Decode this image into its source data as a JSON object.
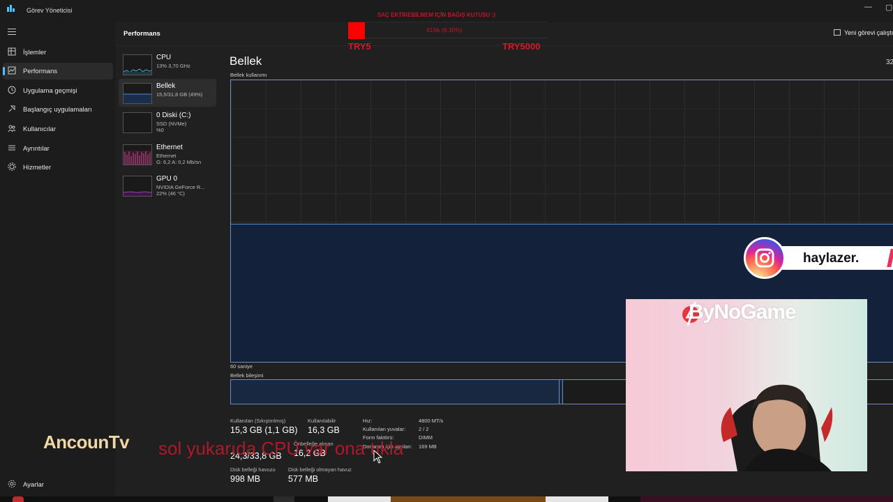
{
  "app": {
    "title": "Görev Yöneticisi"
  },
  "sidebar": {
    "items": [
      {
        "label": "İşlemler",
        "icon": "processes-icon"
      },
      {
        "label": "Performans",
        "icon": "performance-icon",
        "active": true
      },
      {
        "label": "Uygulama geçmişi",
        "icon": "history-icon"
      },
      {
        "label": "Başlangıç uygulamaları",
        "icon": "startup-icon"
      },
      {
        "label": "Kullanıcılar",
        "icon": "users-icon"
      },
      {
        "label": "Ayrıntılar",
        "icon": "details-icon"
      },
      {
        "label": "Hizmetler",
        "icon": "services-icon"
      }
    ],
    "settings_label": "Ayarlar"
  },
  "header": {
    "title": "Performans",
    "new_task": "Yeni görevi çalıştır"
  },
  "perf_list": [
    {
      "name": "CPU",
      "sub1": "13% 3,70 GHz",
      "sub2": "",
      "color": "#4aa8c4"
    },
    {
      "name": "Bellek",
      "sub1": "15,5/31,8 GB (49%)",
      "sub2": "",
      "color": "#5b86c7",
      "active": true
    },
    {
      "name": "0 Diski (C:)",
      "sub1": "SSD (NVMe)",
      "sub2": "%0",
      "color": "#6fa84a"
    },
    {
      "name": "Ethernet",
      "sub1": "Ethernet",
      "sub2": "G: 6,2 A: 0,2 Mb/sn",
      "color": "#c2508a"
    },
    {
      "name": "GPU 0",
      "sub1": "NVIDIA GeForce R...",
      "sub2": "22% (46 °C)",
      "color": "#a040b0"
    }
  ],
  "main": {
    "title": "Bellek",
    "total": "32",
    "usage_label": "Bellek kullanımı",
    "time_label": "60 saniye",
    "composition_label": "Bellek bileşimi",
    "usage_level": 0.49,
    "stats": {
      "in_use_label": "Kullanılan (Sıkıştırılmış)",
      "in_use": "15,3 GB (1,1 GB)",
      "available_label": "Kullanılabilir",
      "available": "16,3 GB",
      "committed": "24,3/33,8 GB",
      "cached_label": "Önbelleğe alınan",
      "cached": "16,2 GB",
      "paged_label": "Disk belleği havuzu",
      "paged": "998 MB",
      "nonpaged_label": "Disk belleği olmayan havuz",
      "nonpaged": "577 MB"
    },
    "specs": [
      {
        "label": "Hız:",
        "value": "4800 MT/s"
      },
      {
        "label": "Kullanılan yuvalar:",
        "value": "2 / 2"
      },
      {
        "label": "Form faktörü:",
        "value": "DIMM"
      },
      {
        "label": "Donanım için ayrılan:",
        "value": "169 MB"
      }
    ]
  },
  "donation": {
    "title": "SAÇ EKTİREBİLMEM İÇİN BAĞIŞ KUTUSU :)",
    "value": "415₺ (8.30%)",
    "progress": 0.083,
    "min": "TRY5",
    "max": "TRY5000"
  },
  "instagram": {
    "handle": "haylazer."
  },
  "webcam": {
    "logo": "ByNoGame"
  },
  "overlay": {
    "streamer": "AncounTv",
    "caption": "sol yukarıda CPU var ona tıkla"
  },
  "colors": {
    "accent": "#4cc2ff",
    "memory": "#5b86c7",
    "donation": "#c1152a"
  }
}
